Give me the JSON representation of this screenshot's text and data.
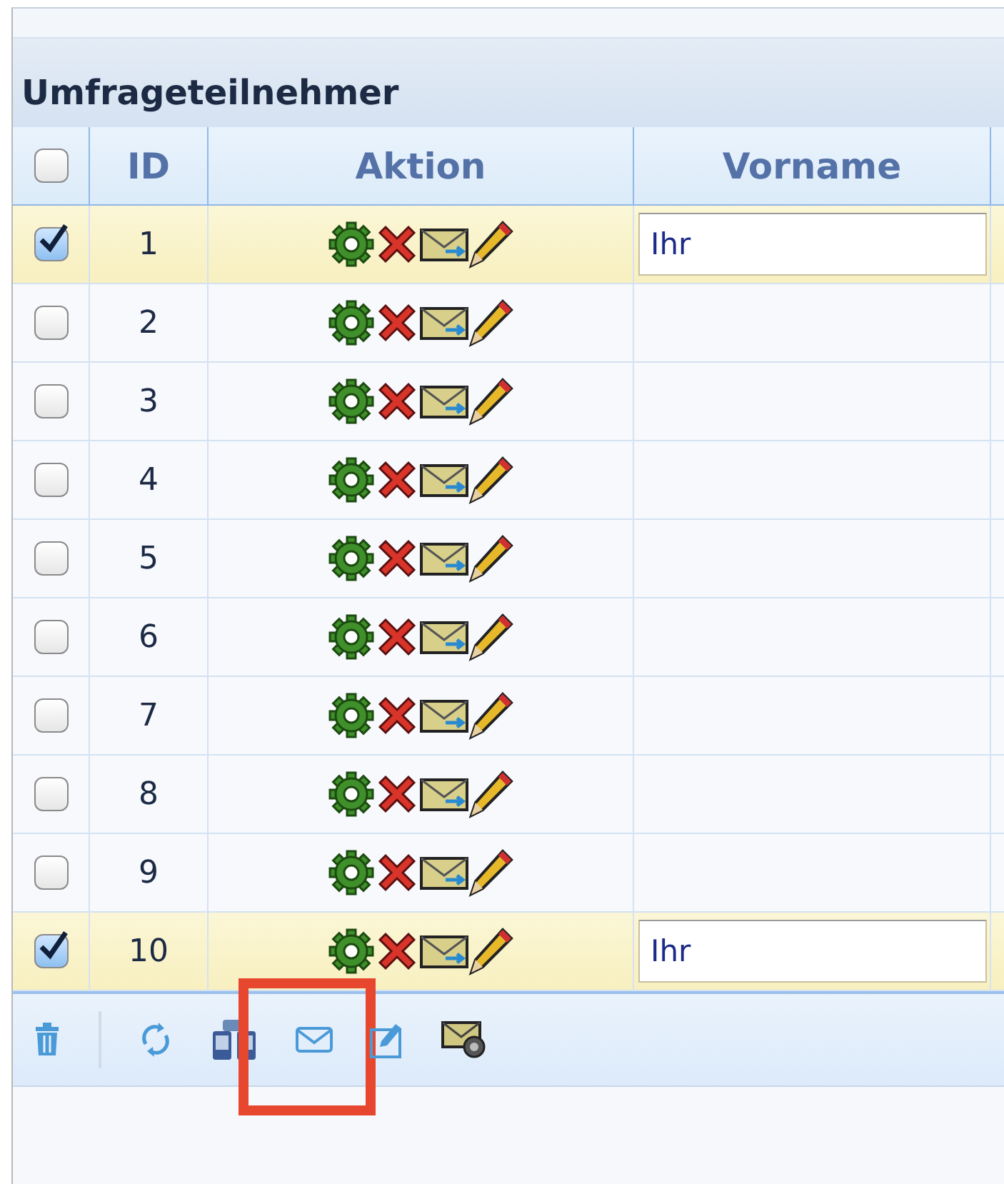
{
  "panel": {
    "title": "Umfrageteilnehmer"
  },
  "table": {
    "columns": [
      {
        "kind": "checkbox",
        "checked": false
      },
      {
        "kind": "text",
        "label": "ID"
      },
      {
        "kind": "text",
        "label": "Aktion"
      },
      {
        "kind": "text",
        "label": "Vorname"
      }
    ],
    "rows": [
      {
        "selected": true,
        "id": "1",
        "vorname": "Ihr"
      },
      {
        "selected": false,
        "id": "2"
      },
      {
        "selected": false,
        "id": "3"
      },
      {
        "selected": false,
        "id": "4"
      },
      {
        "selected": false,
        "id": "5"
      },
      {
        "selected": false,
        "id": "6"
      },
      {
        "selected": false,
        "id": "7"
      },
      {
        "selected": false,
        "id": "8"
      },
      {
        "selected": false,
        "id": "9"
      },
      {
        "selected": true,
        "id": "10",
        "vorname": "Ihr"
      }
    ]
  },
  "toolbar": {
    "buttons": [
      {
        "kind": "delete"
      },
      {
        "kind": "separator"
      },
      {
        "kind": "refresh"
      },
      {
        "kind": "search"
      },
      {
        "kind": "mail",
        "highlighted": true
      },
      {
        "kind": "export"
      },
      {
        "kind": "mail-settings"
      }
    ]
  }
}
